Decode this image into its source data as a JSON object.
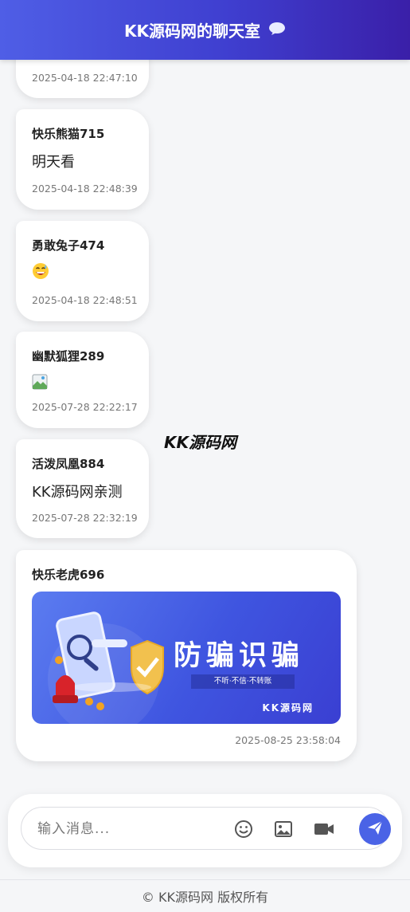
{
  "header": {
    "title": "KK源码网的聊天室",
    "icon": "speech-bubble-icon"
  },
  "messages": [
    {
      "sender": "",
      "type": "text",
      "content": "",
      "time": "2025-04-18 22:47:10"
    },
    {
      "sender": "快乐熊猫715",
      "type": "text",
      "content": "明天看",
      "time": "2025-04-18 22:48:39"
    },
    {
      "sender": "勇敢兔子474",
      "type": "emoji",
      "content": "😅",
      "time": "2025-04-18 22:48:51"
    },
    {
      "sender": "幽默狐狸289",
      "type": "broken-image",
      "content": "",
      "time": "2025-07-28 22:22:17"
    },
    {
      "sender": "活泼凤凰884",
      "type": "text",
      "content": "KK源码网亲测",
      "time": "2025-07-28 22:32:19"
    },
    {
      "sender": "快乐老虎696",
      "type": "image",
      "content": "",
      "time": "2025-08-25 23:58:04",
      "image": {
        "title": "防骗识骗",
        "subtitle": "不听·不信·不转账",
        "brand": "KK源码网"
      }
    }
  ],
  "watermark": "KK源码网",
  "composer": {
    "placeholder": "输入消息...",
    "tools": [
      "emoji-icon",
      "image-icon",
      "video-icon",
      "send-icon"
    ]
  },
  "footer": {
    "text": "© KK源码网 版权所有"
  },
  "colors": {
    "accent": "#4a63e6",
    "header_start": "#4f5ee6",
    "header_end": "#3a1fa8"
  }
}
